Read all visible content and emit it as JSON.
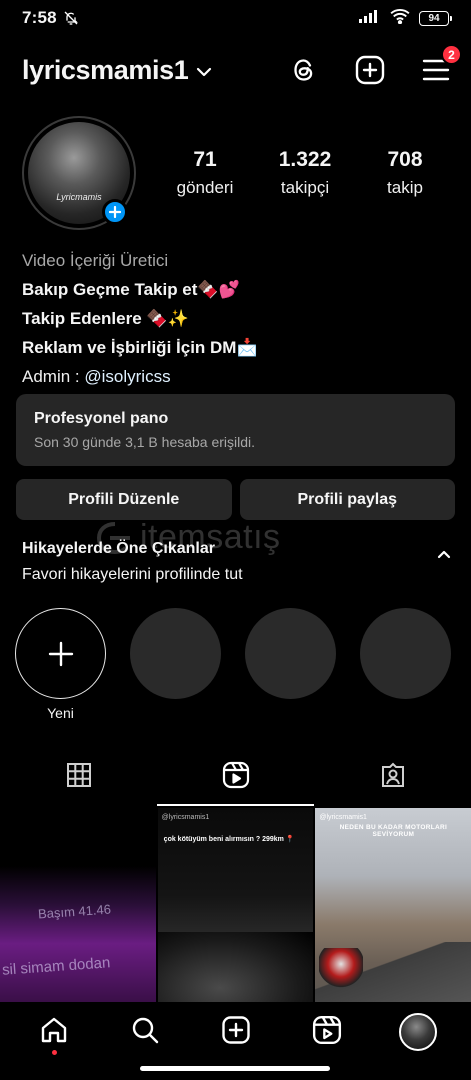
{
  "status_bar": {
    "time": "7:58",
    "battery": "94"
  },
  "header": {
    "username": "lyricsmamis1",
    "notification_count": "2"
  },
  "profile": {
    "avatar_label": "Lyricmamis",
    "stats": [
      {
        "value": "71",
        "label": "gönderi"
      },
      {
        "value": "1.322",
        "label": "takipçi"
      },
      {
        "value": "708",
        "label": "takip"
      }
    ]
  },
  "bio": {
    "category": "Video İçeriği Üretici",
    "line1": "Bakıp Geçme Takip et🍫💕",
    "line2": "Takip Edenlere 🍫✨",
    "line3": "Reklam ve İşbirliği İçin DM📩",
    "admin_prefix": "Admin :  ",
    "admin_handle": "@isolyricss"
  },
  "dashboard": {
    "title": "Profesyonel pano",
    "subtitle": "Son 30 günde 3,1 B hesaba erişildi."
  },
  "buttons": {
    "edit": "Profili Düzenle",
    "share": "Profili paylaş"
  },
  "watermark": "itemsatış",
  "highlights": {
    "title": "Hikayelerde Öne Çıkanlar",
    "subtitle": "Favori hikayelerini profilinde tut",
    "new_label": "Yeni"
  },
  "grid": {
    "post1_text_a": "Başım 41.46",
    "post1_text_b": "sil simam dodan",
    "post2_handle": "@lyricsmamis1",
    "post2_caption": "çok kötüyüm beni alırmısın ? 299km 📍",
    "post3_handle": "@lyricsmamis1",
    "post3_caption": "NEDEN BU KADAR MOTORLARI SEVİYORUM"
  },
  "icons": {
    "header": [
      "threads-icon",
      "create-plus-icon",
      "menu-icon"
    ],
    "tabs": [
      "grid-icon",
      "reels-icon",
      "tagged-icon"
    ],
    "nav": [
      "home-icon",
      "search-icon",
      "create-icon",
      "reels-icon",
      "profile-avatar"
    ]
  }
}
